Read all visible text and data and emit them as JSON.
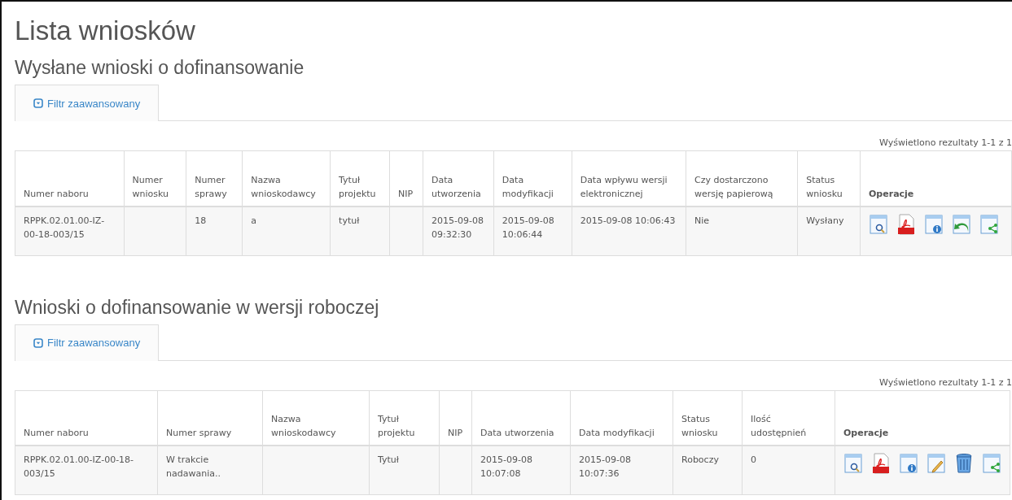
{
  "title": "Lista wniosków",
  "sections": [
    {
      "heading": "Wysłane wnioski o dofinansowanie",
      "tab": {
        "label": "Filtr zaawansowany",
        "selected": true
      },
      "results": "Wyświetlono rezultaty 1-1 z 1",
      "columns": [
        "Numer naboru",
        "Numer wniosku",
        "Numer sprawy",
        "Nazwa wnioskodawcy",
        "Tytuł projektu",
        "NIP",
        "Data utworzenia",
        "Data modyfikacji",
        "Data wpływu wersji elektronicznej",
        "Czy dostarczono wersję papierową",
        "Status wniosku",
        "Operacje"
      ],
      "rows": [
        {
          "cells": [
            "RPPK.02.01.00-IZ-00-18-003/15",
            "",
            "18",
            "a",
            "tytuł",
            "",
            "2015-09-08 09:32:30",
            "2015-09-08 10:06:44",
            "2015-09-08 10:06:43",
            "Nie",
            "Wysłany"
          ],
          "operations": [
            {
              "kind": "preview"
            },
            {
              "kind": "pdf"
            },
            {
              "kind": "info"
            },
            {
              "kind": "return"
            },
            {
              "kind": "share"
            }
          ]
        }
      ]
    },
    {
      "heading": "Wnioski o dofinansowanie w wersji roboczej",
      "tab": {
        "label": "Filtr zaawansowany",
        "selected": true
      },
      "results": "Wyświetlono rezultaty 1-1 z 1",
      "columns": [
        "Numer naboru",
        "Numer sprawy",
        "Nazwa wnioskodawcy",
        "Tytuł projektu",
        "NIP",
        "Data utworzenia",
        "Data modyfikacji",
        "Status wniosku",
        "Ilość udostępnień",
        "Operacje"
      ],
      "rows": [
        {
          "cells": [
            "RPPK.02.01.00-IZ-00-18-003/15",
            "W trakcie nadawania..",
            "",
            "Tytuł",
            "",
            "2015-09-08 10:07:08",
            "2015-09-08 10:07:36",
            "Roboczy",
            "0"
          ],
          "operations": [
            {
              "kind": "preview"
            },
            {
              "kind": "pdf"
            },
            {
              "kind": "info"
            },
            {
              "kind": "edit"
            },
            {
              "kind": "delete"
            },
            {
              "kind": "share"
            }
          ]
        }
      ]
    }
  ]
}
